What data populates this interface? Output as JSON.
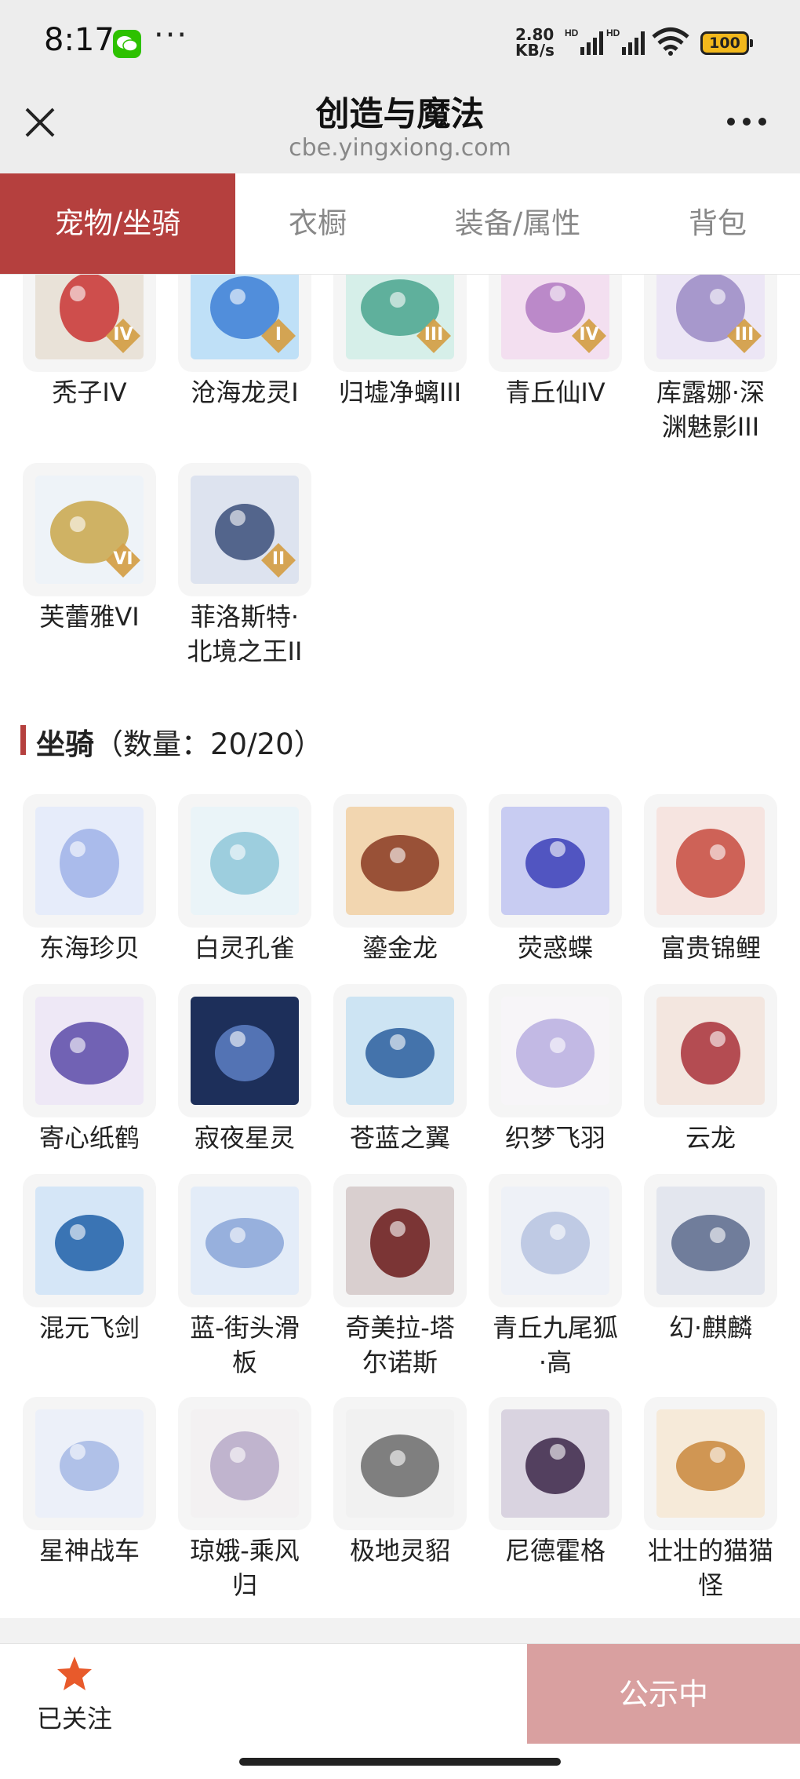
{
  "status_bar": {
    "time": "8:17",
    "speed_value": "2.80",
    "speed_unit": "KB/s",
    "hd_1": "HD",
    "hd_2": "HD",
    "battery": "100",
    "wechat_icon": "wechat-icon",
    "more_glyph": "···"
  },
  "title_bar": {
    "title": "创造与魔法",
    "url": "cbe.yingxiong.com"
  },
  "tabs": [
    "宠物/坐骑",
    "衣橱",
    "装备/属性",
    "背包"
  ],
  "pets": [
    {
      "name": "秃子IV",
      "badge": "IV"
    },
    {
      "name": "沧海龙灵I",
      "badge": "I"
    },
    {
      "name": "归墟净螭III",
      "badge": "III"
    },
    {
      "name": "青丘仙IV",
      "badge": "IV"
    },
    {
      "name": "库露娜·深渊魅影III",
      "badge": "III"
    },
    {
      "name": "芙蕾雅VI",
      "badge": "VI"
    },
    {
      "name": "菲洛斯特·北境之王II",
      "badge": "II"
    }
  ],
  "mounts_section": {
    "title": "坐骑",
    "count": "（数量：20/20）"
  },
  "mounts": [
    "东海珍贝",
    "白灵孔雀",
    "鎏金龙",
    "荧惑蝶",
    "富贵锦鲤",
    "寄心纸鹤",
    "寂夜星灵",
    "苍蓝之翼",
    "织梦飞羽",
    "云龙",
    "混元飞剑",
    "蓝-街头滑板",
    "奇美拉-塔尔诺斯",
    "青丘九尾狐·高",
    "幻·麒麟",
    "星神战车",
    "琼娥-乘风归",
    "极地灵貂",
    "尼德霍格",
    "壮壮的猫猫怪"
  ],
  "bottom_bar": {
    "follow_label": "已关注",
    "publish_label": "公示中"
  },
  "colors": {
    "accent": "#b5403e",
    "publish_button": "#d9a0a0",
    "star": "#e85a2b"
  }
}
